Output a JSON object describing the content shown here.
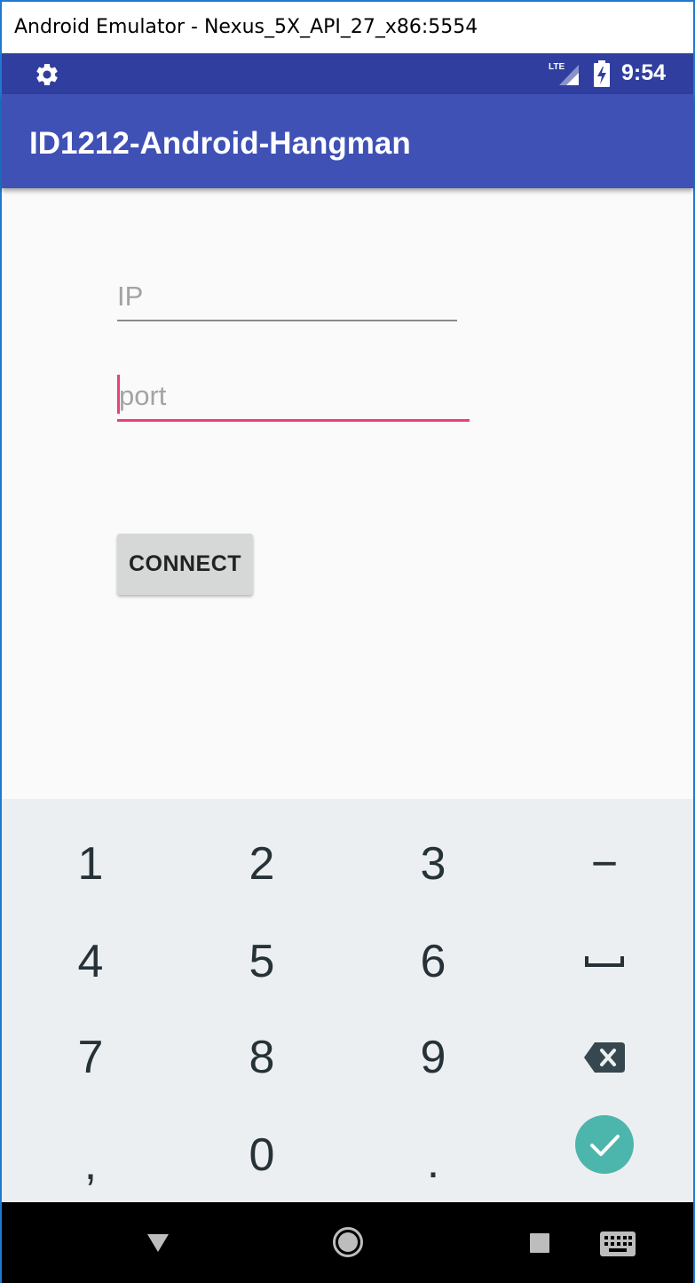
{
  "window": {
    "title": "Android Emulator - Nexus_5X_API_27_x86:5554"
  },
  "status_bar": {
    "time": "9:54",
    "network": "LTE",
    "icons": [
      "gear-icon",
      "lte-signal-icon",
      "battery-charging-icon"
    ],
    "background": "#303f9f"
  },
  "app_bar": {
    "title": "ID1212-Android-Hangman",
    "background": "#3f51b5"
  },
  "form": {
    "ip_placeholder": "IP",
    "port_placeholder": "port",
    "connect_label": "CONNECT",
    "accent": "#e94277"
  },
  "keyboard": {
    "rows": [
      [
        "1",
        "2",
        "3",
        "−"
      ],
      [
        "4",
        "5",
        "6",
        "space"
      ],
      [
        "7",
        "8",
        "9",
        "backspace"
      ],
      [
        ",",
        "0",
        ".",
        "done"
      ]
    ],
    "done_color": "#4db6ac"
  },
  "nav_bar": {
    "icons": [
      "back-icon",
      "home-icon",
      "recents-icon",
      "keyboard-switch-icon"
    ]
  }
}
